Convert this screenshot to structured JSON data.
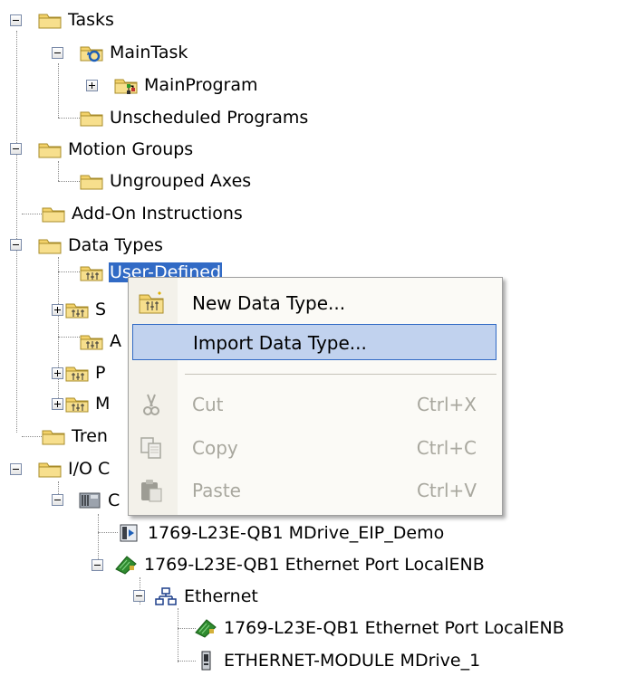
{
  "tree": {
    "items": [
      {
        "label": "Tasks",
        "icon": "folder-icon",
        "expander": "minus"
      },
      {
        "label": "MainTask",
        "icon": "task-icon",
        "expander": "minus"
      },
      {
        "label": "MainProgram",
        "icon": "program-icon",
        "expander": "plus"
      },
      {
        "label": "Unscheduled Programs",
        "icon": "folder-icon",
        "expander": ""
      },
      {
        "label": "Motion Groups",
        "icon": "folder-icon",
        "expander": "minus"
      },
      {
        "label": "Ungrouped Axes",
        "icon": "folder-icon",
        "expander": ""
      },
      {
        "label": "Add-On Instructions",
        "icon": "folder-icon",
        "expander": ""
      },
      {
        "label": "Data Types",
        "icon": "folder-icon",
        "expander": "minus"
      },
      {
        "label": "User-Defined",
        "icon": "datatype-folder-icon",
        "expander": ""
      },
      {
        "label": "S",
        "icon": "datatype-folder-icon",
        "expander": "plus"
      },
      {
        "label": "A",
        "icon": "datatype-folder-icon",
        "expander": ""
      },
      {
        "label": "P",
        "icon": "datatype-folder-icon",
        "expander": "plus"
      },
      {
        "label": "M",
        "icon": "datatype-folder-icon",
        "expander": "plus"
      },
      {
        "label": "Tren",
        "icon": "folder-icon",
        "expander": ""
      },
      {
        "label": "I/O C",
        "icon": "folder-icon",
        "expander": "minus"
      },
      {
        "label": "C",
        "icon": "backplane-icon",
        "expander": "minus"
      },
      {
        "label": "1769-L23E-QB1 MDrive_EIP_Demo",
        "icon": "controller-icon",
        "expander": ""
      },
      {
        "label": "1769-L23E-QB1 Ethernet Port LocalENB",
        "icon": "ethernet-port-icon",
        "expander": "minus"
      },
      {
        "label": "Ethernet",
        "icon": "network-icon",
        "expander": "minus"
      },
      {
        "label": "1769-L23E-QB1 Ethernet Port LocalENB",
        "icon": "ethernet-port-icon",
        "expander": ""
      },
      {
        "label": "ETHERNET-MODULE MDrive_1",
        "icon": "module-icon",
        "expander": ""
      }
    ]
  },
  "context_menu": {
    "items": [
      {
        "label": "New Data Type...",
        "shortcut": "",
        "icon": "new-datatype-icon",
        "enabled": true,
        "highlighted": false
      },
      {
        "label": "Import Data Type...",
        "shortcut": "",
        "icon": "",
        "enabled": true,
        "highlighted": true
      },
      {
        "label": "Cut",
        "shortcut": "Ctrl+X",
        "icon": "scissors-icon",
        "enabled": false,
        "highlighted": false
      },
      {
        "label": "Copy",
        "shortcut": "Ctrl+C",
        "icon": "copy-icon",
        "enabled": false,
        "highlighted": false
      },
      {
        "label": "Paste",
        "shortcut": "Ctrl+V",
        "icon": "paste-icon",
        "enabled": false,
        "highlighted": false
      }
    ]
  },
  "colors": {
    "selection": "#316ac5",
    "menu_highlight": "#c1d2ee",
    "folder": "#f3d26a"
  }
}
